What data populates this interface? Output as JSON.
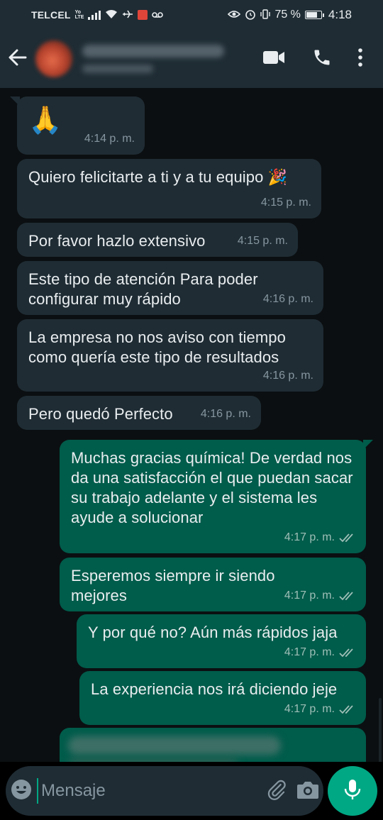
{
  "status_bar": {
    "carrier": "TELCEL",
    "network_tag_top": "Yo",
    "network_tag_bottom": "LTE",
    "battery_percent": "75 %",
    "time": "4:18"
  },
  "header": {
    "back_icon": "arrow-left-icon",
    "video_icon": "video-camera-icon",
    "call_icon": "phone-icon",
    "menu_icon": "more-vertical-icon"
  },
  "messages": [
    {
      "direction": "in",
      "text": "🙏",
      "time": "4:14 p. m."
    },
    {
      "direction": "in",
      "text": "Quiero felicitarte a ti y a tu equipo 🎉",
      "time": "4:15 p. m."
    },
    {
      "direction": "in",
      "text": "Por favor hazlo extensivo",
      "time": "4:15 p. m."
    },
    {
      "direction": "in",
      "text": "Este tipo de atención Para poder configurar muy rápido",
      "time": "4:16 p. m."
    },
    {
      "direction": "in",
      "text": "La empresa no nos aviso con tiempo como quería este tipo de resultados",
      "time": "4:16 p. m."
    },
    {
      "direction": "in",
      "text": "Pero quedó Perfecto",
      "time": "4:16 p. m."
    },
    {
      "direction": "out",
      "text": "Muchas gracias química! De verdad nos da una satisfacción el que puedan sacar su trabajo adelante y el sistema les ayude a solucionar",
      "time": "4:17 p. m.",
      "read": true
    },
    {
      "direction": "out",
      "text": "Esperemos siempre ir siendo mejores",
      "time": "4:17 p. m.",
      "read": true
    },
    {
      "direction": "out",
      "text": "Y por qué no? Aún más rápidos jaja",
      "time": "4:17 p. m.",
      "read": true
    },
    {
      "direction": "out",
      "text": "La experiencia nos irá diciendo jeje",
      "time": "4:17 p. m.",
      "read": true
    }
  ],
  "composer": {
    "placeholder": "Mensaje",
    "emoji_icon": "emoji-icon",
    "attach_icon": "paperclip-icon",
    "camera_icon": "camera-icon",
    "mic_icon": "microphone-icon"
  },
  "colors": {
    "incoming_bubble": "#1f2c34",
    "outgoing_bubble": "#005c4b",
    "accent": "#00a884",
    "background": "#0b0f11"
  }
}
